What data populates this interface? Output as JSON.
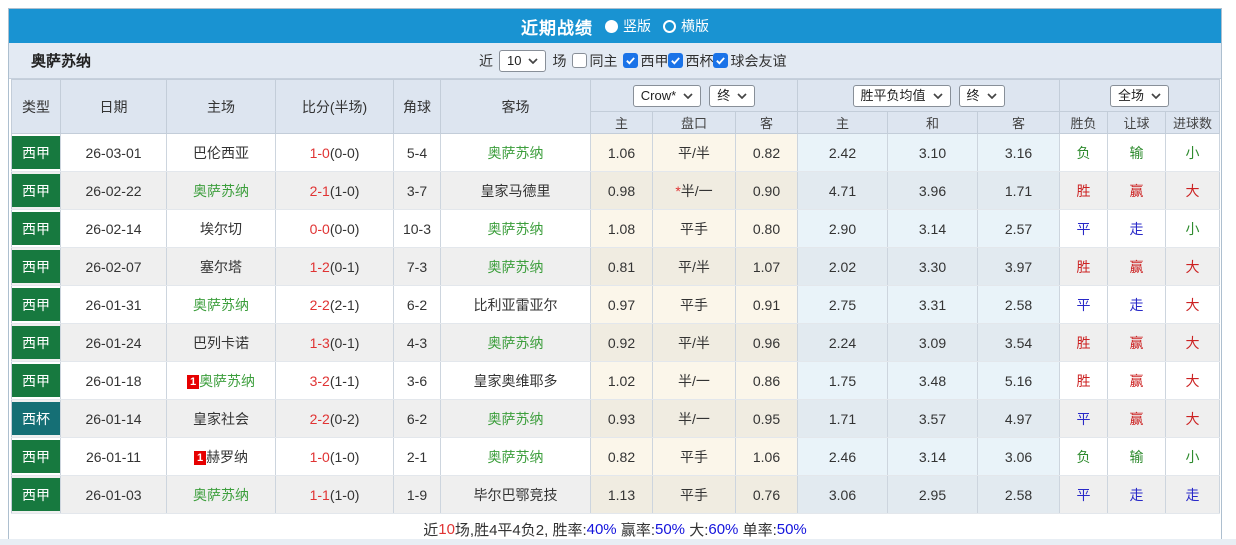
{
  "title_bar": {
    "title": "近期战绩",
    "vertical_label": "竖版",
    "horizontal_label": "横版"
  },
  "toolbar": {
    "team_name": "奥萨苏纳",
    "recent_label": "近",
    "recent_count": "10",
    "unit_label": "场",
    "same_home_label": "同主",
    "filters": [
      {
        "label": "西甲",
        "checked": true
      },
      {
        "label": "西杯",
        "checked": true
      },
      {
        "label": "球会友谊",
        "checked": true
      }
    ]
  },
  "table": {
    "columns": [
      "类型",
      "日期",
      "主场",
      "比分(半场)",
      "角球",
      "客场"
    ],
    "odds_group": {
      "bookmaker": "Crow*",
      "stage": "终",
      "sub_home": "主",
      "sub_handicap": "盘口",
      "sub_away": "客"
    },
    "avg_group": {
      "label": "胜平负均值",
      "stage": "终",
      "sub_home": "主",
      "sub_draw": "和",
      "sub_away": "客"
    },
    "result_group": {
      "label": "全场",
      "sub_wdl": "胜负",
      "sub_handicap": "让球",
      "sub_goals": "进球数"
    },
    "rows": [
      {
        "type": "西甲",
        "type_class": "liga",
        "date": "26-03-01",
        "home_badge": "",
        "home": "巴伦西亚",
        "home_team": false,
        "score": "1-0",
        "half": "(0-0)",
        "corner": "5-4",
        "away": "奥萨苏纳",
        "away_team": true,
        "odds_home": "1.06",
        "handicap_star": "",
        "handicap": "平/半",
        "odds_away": "0.82",
        "avg_home": "2.42",
        "avg_draw": "3.10",
        "avg_away": "3.16",
        "wdl": "负",
        "wdl_color": "green",
        "handicap_result": "输",
        "handicap_result_color": "green",
        "goals_result": "小",
        "goals_result_color": "green"
      },
      {
        "type": "西甲",
        "type_class": "liga",
        "date": "26-02-22",
        "home_badge": "",
        "home": "奥萨苏纳",
        "home_team": true,
        "score": "2-1",
        "half": "(1-0)",
        "corner": "3-7",
        "away": "皇家马德里",
        "away_team": false,
        "odds_home": "0.98",
        "handicap_star": "*",
        "handicap": "半/一",
        "odds_away": "0.90",
        "avg_home": "4.71",
        "avg_draw": "3.96",
        "avg_away": "1.71",
        "wdl": "胜",
        "wdl_color": "red",
        "handicap_result": "赢",
        "handicap_result_color": "red",
        "goals_result": "大",
        "goals_result_color": "red"
      },
      {
        "type": "西甲",
        "type_class": "liga",
        "date": "26-02-14",
        "home_badge": "",
        "home": "埃尔切",
        "home_team": false,
        "score": "0-0",
        "half": "(0-0)",
        "corner": "10-3",
        "away": "奥萨苏纳",
        "away_team": true,
        "odds_home": "1.08",
        "handicap_star": "",
        "handicap": "平手",
        "odds_away": "0.80",
        "avg_home": "2.90",
        "avg_draw": "3.14",
        "avg_away": "2.57",
        "wdl": "平",
        "wdl_color": "blue",
        "handicap_result": "走",
        "handicap_result_color": "blue",
        "goals_result": "小",
        "goals_result_color": "green"
      },
      {
        "type": "西甲",
        "type_class": "liga",
        "date": "26-02-07",
        "home_badge": "",
        "home": "塞尔塔",
        "home_team": false,
        "score": "1-2",
        "half": "(0-1)",
        "corner": "7-3",
        "away": "奥萨苏纳",
        "away_team": true,
        "odds_home": "0.81",
        "handicap_star": "",
        "handicap": "平/半",
        "odds_away": "1.07",
        "avg_home": "2.02",
        "avg_draw": "3.30",
        "avg_away": "3.97",
        "wdl": "胜",
        "wdl_color": "red",
        "handicap_result": "赢",
        "handicap_result_color": "red",
        "goals_result": "大",
        "goals_result_color": "red"
      },
      {
        "type": "西甲",
        "type_class": "liga",
        "date": "26-01-31",
        "home_badge": "",
        "home": "奥萨苏纳",
        "home_team": true,
        "score": "2-2",
        "half": "(2-1)",
        "corner": "6-2",
        "away": "比利亚雷亚尔",
        "away_team": false,
        "odds_home": "0.97",
        "handicap_star": "",
        "handicap": "平手",
        "odds_away": "0.91",
        "avg_home": "2.75",
        "avg_draw": "3.31",
        "avg_away": "2.58",
        "wdl": "平",
        "wdl_color": "blue",
        "handicap_result": "走",
        "handicap_result_color": "blue",
        "goals_result": "大",
        "goals_result_color": "red"
      },
      {
        "type": "西甲",
        "type_class": "liga",
        "date": "26-01-24",
        "home_badge": "",
        "home": "巴列卡诺",
        "home_team": false,
        "score": "1-3",
        "half": "(0-1)",
        "corner": "4-3",
        "away": "奥萨苏纳",
        "away_team": true,
        "odds_home": "0.92",
        "handicap_star": "",
        "handicap": "平/半",
        "odds_away": "0.96",
        "avg_home": "2.24",
        "avg_draw": "3.09",
        "avg_away": "3.54",
        "wdl": "胜",
        "wdl_color": "red",
        "handicap_result": "赢",
        "handicap_result_color": "red",
        "goals_result": "大",
        "goals_result_color": "red"
      },
      {
        "type": "西甲",
        "type_class": "liga",
        "date": "26-01-18",
        "home_badge": "1",
        "home": "奥萨苏纳",
        "home_team": true,
        "score": "3-2",
        "half": "(1-1)",
        "corner": "3-6",
        "away": "皇家奥维耶多",
        "away_team": false,
        "odds_home": "1.02",
        "handicap_star": "",
        "handicap": "半/一",
        "odds_away": "0.86",
        "avg_home": "1.75",
        "avg_draw": "3.48",
        "avg_away": "5.16",
        "wdl": "胜",
        "wdl_color": "red",
        "handicap_result": "赢",
        "handicap_result_color": "red",
        "goals_result": "大",
        "goals_result_color": "red"
      },
      {
        "type": "西杯",
        "type_class": "cup",
        "date": "26-01-14",
        "home_badge": "",
        "home": "皇家社会",
        "home_team": false,
        "score": "2-2",
        "half": "(0-2)",
        "corner": "6-2",
        "away": "奥萨苏纳",
        "away_team": true,
        "odds_home": "0.93",
        "handicap_star": "",
        "handicap": "半/一",
        "odds_away": "0.95",
        "avg_home": "1.71",
        "avg_draw": "3.57",
        "avg_away": "4.97",
        "wdl": "平",
        "wdl_color": "blue",
        "handicap_result": "赢",
        "handicap_result_color": "red",
        "goals_result": "大",
        "goals_result_color": "red"
      },
      {
        "type": "西甲",
        "type_class": "liga",
        "date": "26-01-11",
        "home_badge": "1",
        "home": "赫罗纳",
        "home_team": false,
        "score": "1-0",
        "half": "(1-0)",
        "corner": "2-1",
        "away": "奥萨苏纳",
        "away_team": true,
        "odds_home": "0.82",
        "handicap_star": "",
        "handicap": "平手",
        "odds_away": "1.06",
        "avg_home": "2.46",
        "avg_draw": "3.14",
        "avg_away": "3.06",
        "wdl": "负",
        "wdl_color": "green",
        "handicap_result": "输",
        "handicap_result_color": "green",
        "goals_result": "小",
        "goals_result_color": "green"
      },
      {
        "type": "西甲",
        "type_class": "liga",
        "date": "26-01-03",
        "home_badge": "",
        "home": "奥萨苏纳",
        "home_team": true,
        "score": "1-1",
        "half": "(1-0)",
        "corner": "1-9",
        "away": "毕尔巴鄂竞技",
        "away_team": false,
        "odds_home": "1.13",
        "handicap_star": "",
        "handicap": "平手",
        "odds_away": "0.76",
        "avg_home": "3.06",
        "avg_draw": "2.95",
        "avg_away": "2.58",
        "wdl": "平",
        "wdl_color": "blue",
        "handicap_result": "走",
        "handicap_result_color": "blue",
        "goals_result": "走",
        "goals_result_color": "blue"
      }
    ]
  },
  "footer": {
    "segments": [
      {
        "text": "近",
        "color": "dark"
      },
      {
        "text": "10",
        "color": "red"
      },
      {
        "text": "场,胜4平4负2, 胜率:",
        "color": "dark"
      },
      {
        "text": "40%",
        "color": "blue"
      },
      {
        "text": " 赢率:",
        "color": "dark"
      },
      {
        "text": "50%",
        "color": "blue"
      },
      {
        "text": " 大:",
        "color": "dark"
      },
      {
        "text": "60%",
        "color": "blue"
      },
      {
        "text": " 单率:",
        "color": "dark"
      },
      {
        "text": "50%",
        "color": "blue"
      }
    ]
  },
  "colors": {
    "accent_blue": "#1993d2",
    "liga_green": "#17793f",
    "cup_teal": "#156f75",
    "score_red": "#e03333",
    "win_red": "#cc2222",
    "draw_blue": "#2929c8",
    "lose_green": "#2e8b2e",
    "team_green": "#3c9e3c",
    "checkbox_blue": "#1a73e8"
  }
}
